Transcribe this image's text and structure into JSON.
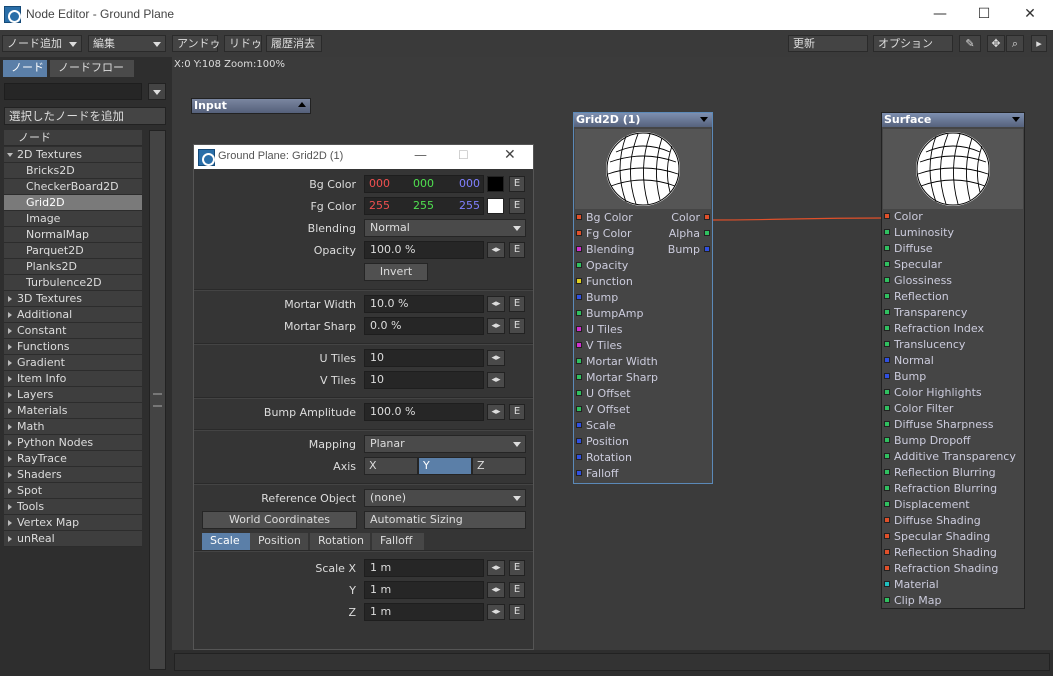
{
  "window": {
    "title": "Node Editor - Ground Plane",
    "min": "—",
    "max": "☐",
    "close": "✕"
  },
  "toolbar": {
    "add_node": "ノード追加",
    "edit": "編集",
    "undo": "アンドゥ",
    "redo": "リドゥ",
    "history_clear": "履歴消去",
    "update": "更新",
    "options": "オプション"
  },
  "left": {
    "tab_nodes": "ノード",
    "tab_nodeflow": "ノードフロー",
    "add_selected": "選択したノードを追加",
    "list_header": "ノード",
    "items": [
      {
        "label": "2D Textures",
        "kind": "open"
      },
      {
        "label": "Bricks2D",
        "kind": "child"
      },
      {
        "label": "CheckerBoard2D",
        "kind": "child"
      },
      {
        "label": "Grid2D",
        "kind": "child",
        "selected": true
      },
      {
        "label": "Image",
        "kind": "child"
      },
      {
        "label": "NormalMap",
        "kind": "child"
      },
      {
        "label": "Parquet2D",
        "kind": "child"
      },
      {
        "label": "Planks2D",
        "kind": "child"
      },
      {
        "label": "Turbulence2D",
        "kind": "child"
      },
      {
        "label": "3D Textures",
        "kind": "cat"
      },
      {
        "label": "Additional",
        "kind": "cat"
      },
      {
        "label": "Constant",
        "kind": "cat"
      },
      {
        "label": "Functions",
        "kind": "cat"
      },
      {
        "label": "Gradient",
        "kind": "cat"
      },
      {
        "label": "Item Info",
        "kind": "cat"
      },
      {
        "label": "Layers",
        "kind": "cat"
      },
      {
        "label": "Materials",
        "kind": "cat"
      },
      {
        "label": "Math",
        "kind": "cat"
      },
      {
        "label": "Python Nodes",
        "kind": "cat"
      },
      {
        "label": "RayTrace",
        "kind": "cat"
      },
      {
        "label": "Shaders",
        "kind": "cat"
      },
      {
        "label": "Spot",
        "kind": "cat"
      },
      {
        "label": "Tools",
        "kind": "cat"
      },
      {
        "label": "Vertex Map",
        "kind": "cat"
      },
      {
        "label": "unReal",
        "kind": "cat"
      }
    ]
  },
  "canvas": {
    "coords": "X:0 Y:108 Zoom:100%",
    "input_node": "Input"
  },
  "grid_node": {
    "title": "Grid2D (1)",
    "inputs": [
      {
        "label": "Bg Color",
        "color": "#e0502a"
      },
      {
        "label": "Fg Color",
        "color": "#e0502a"
      },
      {
        "label": "Blending",
        "color": "#d030d0"
      },
      {
        "label": "Opacity",
        "color": "#30c060"
      },
      {
        "label": "Function",
        "color": "#e0d020"
      },
      {
        "label": "Bump",
        "color": "#3050e0"
      },
      {
        "label": "BumpAmp",
        "color": "#30c060"
      },
      {
        "label": "U Tiles",
        "color": "#d030d0"
      },
      {
        "label": "V Tiles",
        "color": "#d030d0"
      },
      {
        "label": "Mortar Width",
        "color": "#30c060"
      },
      {
        "label": "Mortar Sharp",
        "color": "#30c060"
      },
      {
        "label": "U Offset",
        "color": "#30c060"
      },
      {
        "label": "V Offset",
        "color": "#30c060"
      },
      {
        "label": "Scale",
        "color": "#3050e0"
      },
      {
        "label": "Position",
        "color": "#3050e0"
      },
      {
        "label": "Rotation",
        "color": "#3050e0"
      },
      {
        "label": "Falloff",
        "color": "#3050e0"
      }
    ],
    "outputs": [
      {
        "label": "Color",
        "color": "#e0502a"
      },
      {
        "label": "Alpha",
        "color": "#30c060"
      },
      {
        "label": "Bump",
        "color": "#3050e0"
      }
    ]
  },
  "surface_node": {
    "title": "Surface",
    "inputs": [
      {
        "label": "Color",
        "color": "#e0502a"
      },
      {
        "label": "Luminosity",
        "color": "#30c060"
      },
      {
        "label": "Diffuse",
        "color": "#30c060"
      },
      {
        "label": "Specular",
        "color": "#30c060"
      },
      {
        "label": "Glossiness",
        "color": "#30c060"
      },
      {
        "label": "Reflection",
        "color": "#30c060"
      },
      {
        "label": "Transparency",
        "color": "#30c060"
      },
      {
        "label": "Refraction Index",
        "color": "#30c060"
      },
      {
        "label": "Translucency",
        "color": "#30c060"
      },
      {
        "label": "Normal",
        "color": "#3050e0"
      },
      {
        "label": "Bump",
        "color": "#3050e0"
      },
      {
        "label": "Color Highlights",
        "color": "#30c060"
      },
      {
        "label": "Color Filter",
        "color": "#30c060"
      },
      {
        "label": "Diffuse Sharpness",
        "color": "#30c060"
      },
      {
        "label": "Bump Dropoff",
        "color": "#30c060"
      },
      {
        "label": "Additive Transparency",
        "color": "#30c060"
      },
      {
        "label": "Reflection Blurring",
        "color": "#30c060"
      },
      {
        "label": "Refraction Blurring",
        "color": "#30c060"
      },
      {
        "label": "Displacement",
        "color": "#30c060"
      },
      {
        "label": "Diffuse Shading",
        "color": "#e0502a"
      },
      {
        "label": "Specular Shading",
        "color": "#e0502a"
      },
      {
        "label": "Reflection Shading",
        "color": "#e0502a"
      },
      {
        "label": "Refraction Shading",
        "color": "#e0502a"
      },
      {
        "label": "Material",
        "color": "#20c0c0"
      },
      {
        "label": "Clip Map",
        "color": "#30c060"
      }
    ]
  },
  "dialog": {
    "title": "Ground Plane: Grid2D (1)",
    "bg_label": "Bg Color",
    "bg_r": "000",
    "bg_g": "000",
    "bg_b": "000",
    "fg_label": "Fg Color",
    "fg_r": "255",
    "fg_g": "255",
    "fg_b": "255",
    "blending_label": "Blending",
    "blending_value": "Normal",
    "opacity_label": "Opacity",
    "opacity_value": "100.0 %",
    "invert": "Invert",
    "mortar_width_label": "Mortar Width",
    "mortar_width_value": "10.0 %",
    "mortar_sharp_label": "Mortar Sharp",
    "mortar_sharp_value": "0.0 %",
    "utiles_label": "U Tiles",
    "utiles_value": "10",
    "vtiles_label": "V Tiles",
    "vtiles_value": "10",
    "bump_label": "Bump Amplitude",
    "bump_value": "100.0 %",
    "mapping_label": "Mapping",
    "mapping_value": "Planar",
    "axis_label": "Axis",
    "axis_x": "X",
    "axis_y": "Y",
    "axis_z": "Z",
    "ref_label": "Reference Object",
    "ref_value": "(none)",
    "world_coords": "World Coordinates",
    "auto_sizing": "Automatic Sizing",
    "tab_scale": "Scale",
    "tab_position": "Position",
    "tab_rotation": "Rotation",
    "tab_falloff": "Falloff",
    "scale_x_label": "Scale X",
    "scale_x": "1 m",
    "scale_y_label": "Y",
    "scale_y": "1 m",
    "scale_z_label": "Z",
    "scale_z": "1 m",
    "e": "E",
    "spin": "◂▸"
  }
}
